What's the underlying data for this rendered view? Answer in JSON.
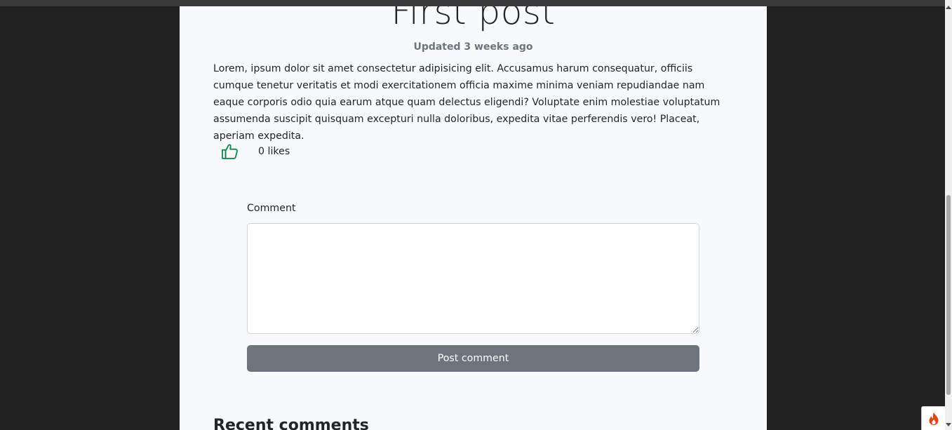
{
  "post": {
    "title": "First post",
    "updated": "Updated 3 weeks ago",
    "body": "Lorem, ipsum dolor sit amet consectetur adipisicing elit. Accusamus harum consequatur, officiis cumque tenetur veritatis et modi exercitationem officia maxime minima veniam repudiandae nam eaque corporis odio quia earum atque quam delectus eligendi? Voluptate enim molestiae voluptatum assumenda suscipit quisquam excepturi nulla doloribus, expedita vitae perferendis vero! Placeat, aperiam expedita.",
    "likes_label": "0 likes",
    "like_icon": "thumbs-up-icon"
  },
  "comment_form": {
    "label": "Comment",
    "value": "",
    "submit_label": "Post comment"
  },
  "recent_comments": {
    "heading": "Recent comments"
  },
  "debug_toolbar": {
    "icon": "flame-icon"
  },
  "colors": {
    "page_bg": "#212121",
    "card_bg": "#f8f9fa",
    "like_icon": "#198754",
    "button_bg": "#6c757d",
    "debug_icon": "#dd4814"
  }
}
